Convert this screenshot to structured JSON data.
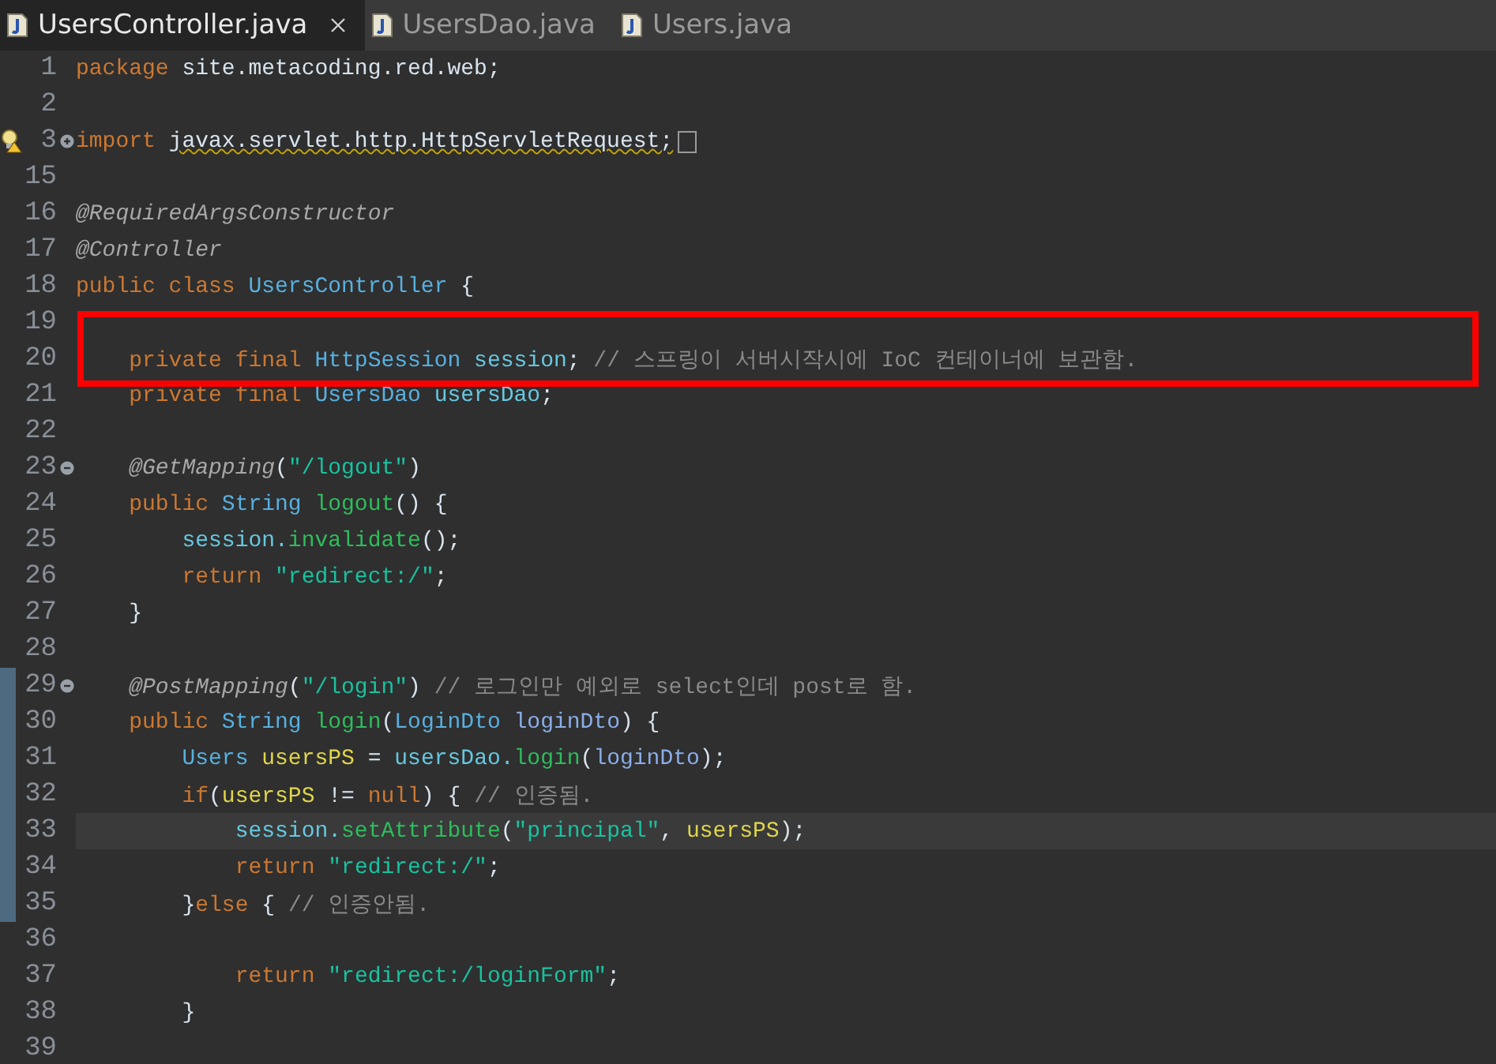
{
  "tabs": [
    {
      "label": "UsersController.java",
      "selected": true,
      "closable": true
    },
    {
      "label": "UsersDao.java",
      "selected": false,
      "closable": false
    },
    {
      "label": "Users.java",
      "selected": false,
      "closable": false
    }
  ],
  "lines": [
    {
      "number": "1",
      "tokens": [
        {
          "kind": "kw",
          "text": "package"
        },
        {
          "kind": "plain",
          "text": " site.metacoding.red.web;"
        }
      ]
    },
    {
      "number": "2"
    },
    {
      "number": "3",
      "collapsible": true,
      "collapsed": true,
      "warning": true,
      "tokens": [
        {
          "kind": "kw",
          "text": "import "
        },
        {
          "kind": "squiggly",
          "text": "javax.servlet.http.HttpServletRequest;"
        }
      ]
    },
    {
      "number": "15"
    },
    {
      "number": "16",
      "tokens": [
        {
          "kind": "ann",
          "text": "@RequiredArgsConstructor"
        }
      ]
    },
    {
      "number": "17",
      "tokens": [
        {
          "kind": "ann",
          "text": "@Controller"
        }
      ]
    },
    {
      "number": "18",
      "tokens": [
        {
          "kind": "kw",
          "text": "public class "
        },
        {
          "kind": "type",
          "text": "UsersController"
        },
        {
          "kind": "plain",
          "text": " {"
        }
      ]
    },
    {
      "number": "19",
      "boxed": true
    },
    {
      "number": "20",
      "boxed": true,
      "tokens": [
        {
          "kind": "kw",
          "text": "    private final"
        },
        {
          "kind": "type",
          "text": " HttpSession"
        },
        {
          "kind": "field",
          "text": " session"
        },
        {
          "kind": "plain",
          "text": ";"
        },
        {
          "kind": "comment",
          "text": " // 스프링이 서버시작시에 IoC 컨테이너에 보관함."
        }
      ]
    },
    {
      "number": "21",
      "tokens": [
        {
          "kind": "kw",
          "text": "    private final"
        },
        {
          "kind": "type",
          "text": " UsersDao"
        },
        {
          "kind": "field",
          "text": " usersDao"
        },
        {
          "kind": "plain",
          "text": ";"
        }
      ]
    },
    {
      "number": "22"
    },
    {
      "number": "23",
      "collapsible": true,
      "collapsed": false,
      "tokens": [
        {
          "kind": "ann",
          "text": "    @GetMapping"
        },
        {
          "kind": "plain",
          "text": "("
        },
        {
          "kind": "str",
          "text": "\"/logout\""
        },
        {
          "kind": "plain",
          "text": ")"
        }
      ]
    },
    {
      "number": "24",
      "tokens": [
        {
          "kind": "kw",
          "text": "    public"
        },
        {
          "kind": "type",
          "text": " String"
        },
        {
          "kind": "method",
          "text": " logout"
        },
        {
          "kind": "plain",
          "text": "() {"
        }
      ]
    },
    {
      "number": "25",
      "tokens": [
        {
          "kind": "field",
          "text": "        session."
        },
        {
          "kind": "method",
          "text": "invalidate"
        },
        {
          "kind": "plain",
          "text": "();"
        }
      ]
    },
    {
      "number": "26",
      "tokens": [
        {
          "kind": "kw",
          "text": "        return"
        },
        {
          "kind": "str",
          "text": " \"redirect:/\""
        },
        {
          "kind": "plain",
          "text": ";"
        }
      ]
    },
    {
      "number": "27",
      "tokens": [
        {
          "kind": "plain",
          "text": "    }"
        }
      ]
    },
    {
      "number": "28"
    },
    {
      "number": "29",
      "collapsible": true,
      "collapsed": false,
      "changed": true,
      "tokens": [
        {
          "kind": "ann",
          "text": "    @PostMapping"
        },
        {
          "kind": "plain",
          "text": "("
        },
        {
          "kind": "str",
          "text": "\"/login\""
        },
        {
          "kind": "plain",
          "text": ")"
        },
        {
          "kind": "comment",
          "text": " // 로그인만 예외로 select인데 post로 함."
        }
      ]
    },
    {
      "number": "30",
      "changed": true,
      "tokens": [
        {
          "kind": "kw",
          "text": "    public"
        },
        {
          "kind": "type",
          "text": " String"
        },
        {
          "kind": "method",
          "text": " login"
        },
        {
          "kind": "plain",
          "text": "("
        },
        {
          "kind": "type",
          "text": "LoginDto"
        },
        {
          "kind": "param",
          "text": " loginDto"
        },
        {
          "kind": "plain",
          "text": ") {"
        }
      ]
    },
    {
      "number": "31",
      "changed": true,
      "tokens": [
        {
          "kind": "type",
          "text": "        Users"
        },
        {
          "kind": "local",
          "text": " usersPS"
        },
        {
          "kind": "plain",
          "text": " = "
        },
        {
          "kind": "field",
          "text": "usersDao."
        },
        {
          "kind": "method",
          "text": "login"
        },
        {
          "kind": "plain",
          "text": "("
        },
        {
          "kind": "param",
          "text": "loginDto"
        },
        {
          "kind": "plain",
          "text": ");"
        }
      ]
    },
    {
      "number": "32",
      "changed": true,
      "tokens": [
        {
          "kind": "kw",
          "text": "        if"
        },
        {
          "kind": "plain",
          "text": "("
        },
        {
          "kind": "local",
          "text": "usersPS"
        },
        {
          "kind": "plain",
          "text": " != "
        },
        {
          "kind": "kw",
          "text": "null"
        },
        {
          "kind": "plain",
          "text": ") { "
        },
        {
          "kind": "comment",
          "text": "// 인증됨."
        }
      ]
    },
    {
      "number": "33",
      "changed": true,
      "highlighted": true,
      "tokens": [
        {
          "kind": "field",
          "text": "            session."
        },
        {
          "kind": "method",
          "text": "setAttribute"
        },
        {
          "kind": "plain",
          "text": "("
        },
        {
          "kind": "str",
          "text": "\"principal\""
        },
        {
          "kind": "plain",
          "text": ", "
        },
        {
          "kind": "local",
          "text": "usersPS"
        },
        {
          "kind": "plain",
          "text": ");"
        }
      ]
    },
    {
      "number": "34",
      "changed": true,
      "tokens": [
        {
          "kind": "kw",
          "text": "            return"
        },
        {
          "kind": "str",
          "text": " \"redirect:/\""
        },
        {
          "kind": "plain",
          "text": ";"
        }
      ]
    },
    {
      "number": "35",
      "changed": true,
      "tokens": [
        {
          "kind": "plain",
          "text": "        }"
        },
        {
          "kind": "kw",
          "text": "else"
        },
        {
          "kind": "plain",
          "text": " { "
        },
        {
          "kind": "comment",
          "text": "// 인증안됨."
        }
      ]
    },
    {
      "number": "36"
    },
    {
      "number": "37",
      "tokens": [
        {
          "kind": "kw",
          "text": "            return"
        },
        {
          "kind": "str",
          "text": " \"redirect:/loginForm\""
        },
        {
          "kind": "plain",
          "text": ";"
        }
      ]
    },
    {
      "number": "38",
      "tokens": [
        {
          "kind": "plain",
          "text": "        }"
        }
      ]
    },
    {
      "number": "39"
    }
  ]
}
